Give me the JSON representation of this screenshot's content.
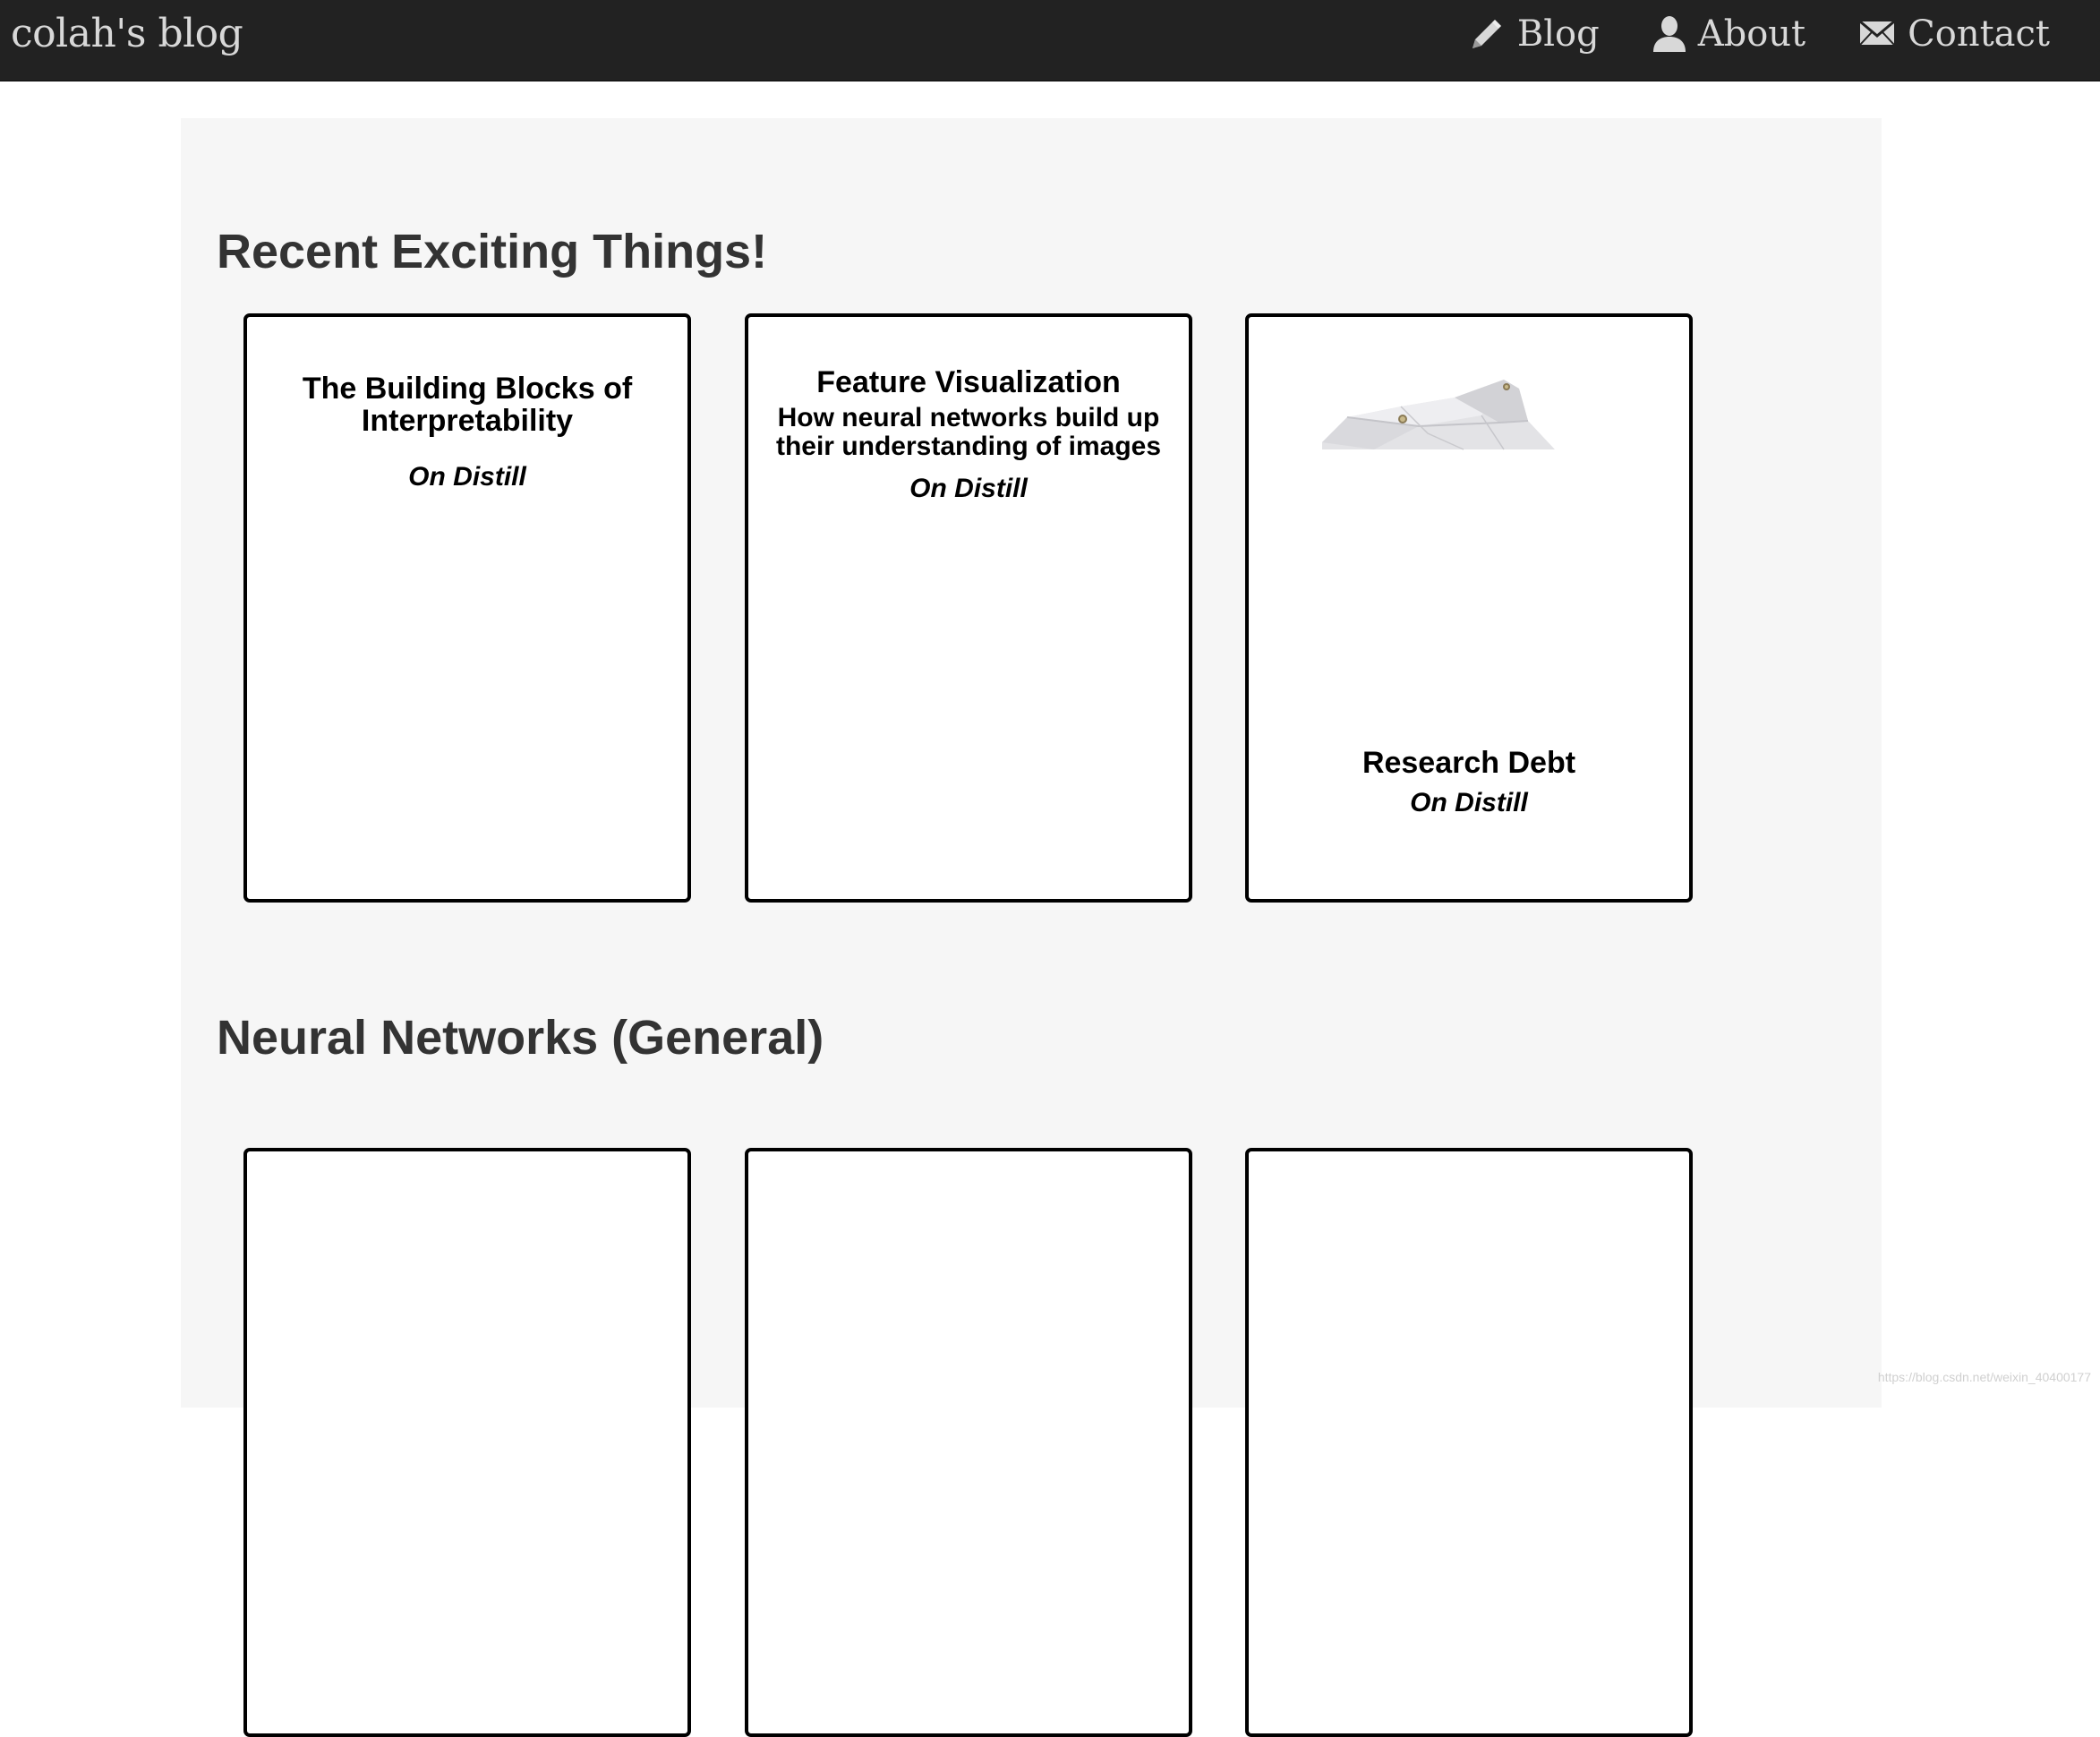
{
  "navbar": {
    "brand": "colah's blog",
    "links": [
      {
        "label": "Blog",
        "icon": "pencil-icon"
      },
      {
        "label": "About",
        "icon": "person-icon"
      },
      {
        "label": "Contact",
        "icon": "envelope-icon"
      }
    ]
  },
  "sections": [
    {
      "title": "Recent Exciting Things!",
      "cards": [
        {
          "title": "The Building Blocks of Interpretability",
          "venue": "On Distill"
        },
        {
          "title": "Feature Visualization",
          "subtitle": "How neural networks build up their understanding of images",
          "venue": "On Distill"
        },
        {
          "title": "Research Debt",
          "venue": "On Distill",
          "image": "crumpled-paper-image"
        }
      ]
    },
    {
      "title": "Neural Networks (General)",
      "cards": [
        {
          "title": ""
        },
        {
          "title": ""
        },
        {
          "title": ""
        }
      ]
    }
  ],
  "watermark": "https://blog.csdn.net/weixin_40400177",
  "colors": {
    "navbar_bg": "#222222",
    "nav_text": "#d8d8d8",
    "content_bg": "#f6f6f6",
    "heading": "#333333",
    "card_border": "#000000"
  }
}
